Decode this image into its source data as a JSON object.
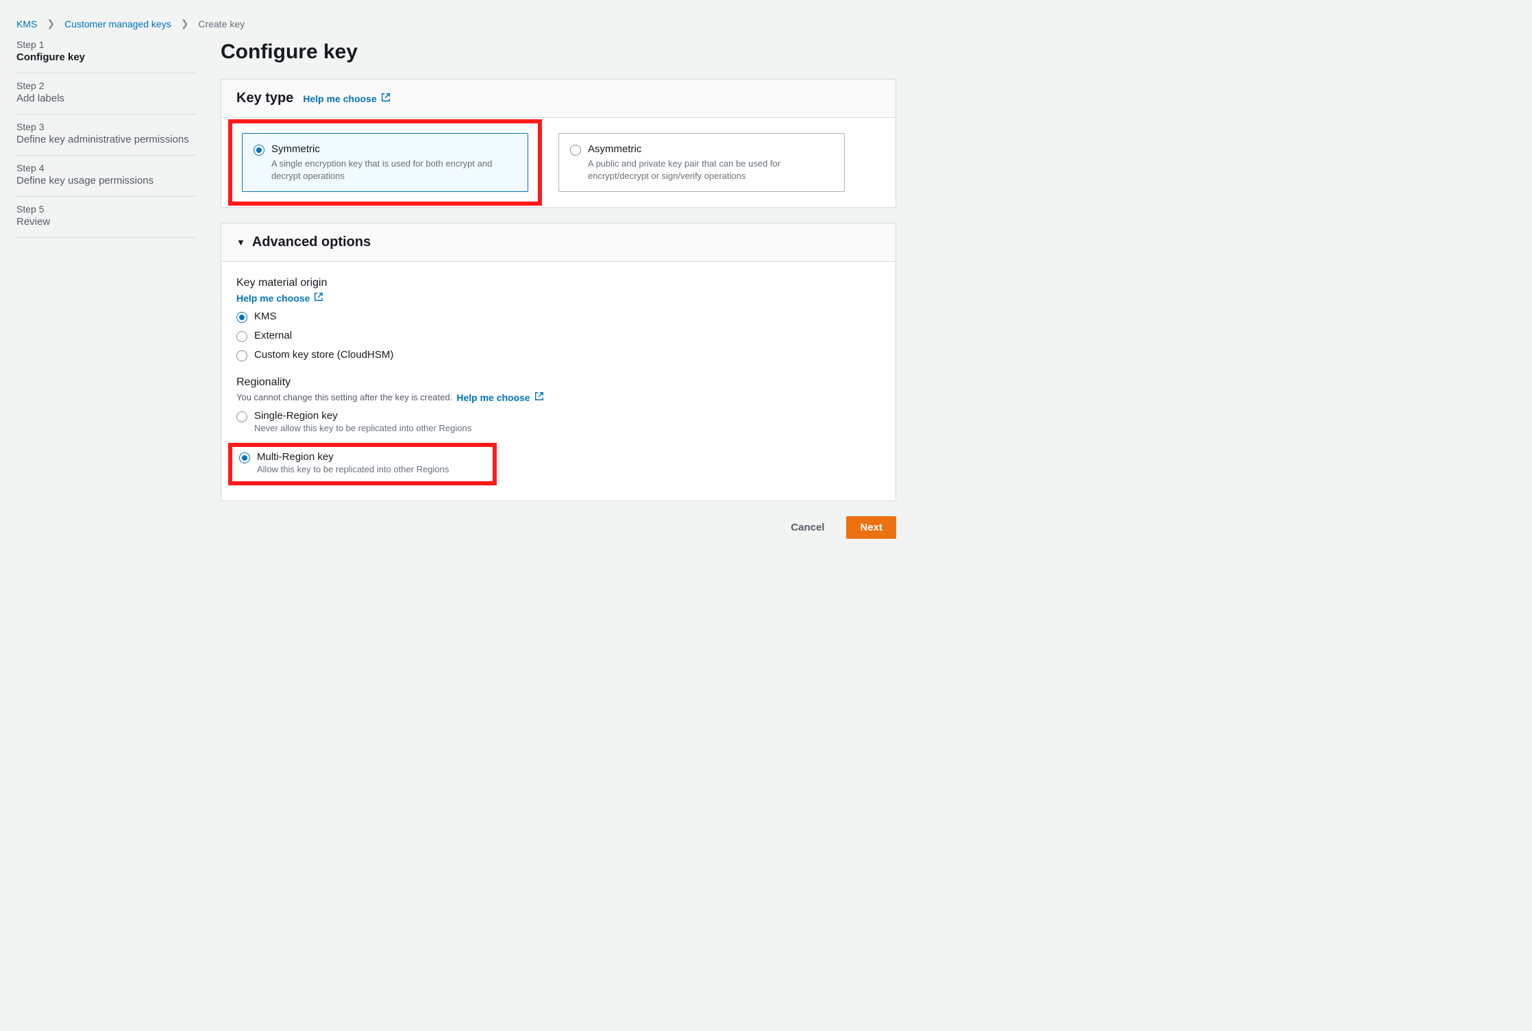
{
  "breadcrumb": {
    "root": "KMS",
    "mid": "Customer managed keys",
    "current": "Create key"
  },
  "sidebar": {
    "steps": [
      {
        "num": "Step 1",
        "title": "Configure key"
      },
      {
        "num": "Step 2",
        "title": "Add labels"
      },
      {
        "num": "Step 3",
        "title": "Define key administrative permissions"
      },
      {
        "num": "Step 4",
        "title": "Define key usage permissions"
      },
      {
        "num": "Step 5",
        "title": "Review"
      }
    ]
  },
  "page": {
    "title": "Configure key"
  },
  "keytype": {
    "panel_title": "Key type",
    "help": "Help me choose",
    "symmetric": {
      "label": "Symmetric",
      "desc": "A single encryption key that is used for both encrypt and decrypt operations"
    },
    "asymmetric": {
      "label": "Asymmetric",
      "desc": "A public and private key pair that can be used for encrypt/decrypt or sign/verify operations"
    }
  },
  "advanced": {
    "panel_title": "Advanced options",
    "kmo": {
      "title": "Key material origin",
      "help": "Help me choose",
      "kms": "KMS",
      "external": "External",
      "custom": "Custom key store (CloudHSM)"
    },
    "regionality": {
      "title": "Regionality",
      "note": "You cannot change this setting after the key is created.",
      "help": "Help me choose",
      "single": {
        "label": "Single-Region key",
        "desc": "Never allow this key to be replicated into other Regions"
      },
      "multi": {
        "label": "Multi-Region key",
        "desc": "Allow this key to be replicated into other Regions"
      }
    }
  },
  "footer": {
    "cancel": "Cancel",
    "next": "Next"
  }
}
